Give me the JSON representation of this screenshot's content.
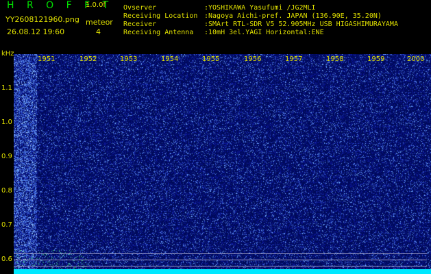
{
  "app": {
    "title": "H R O F F T",
    "version": "1.0.0f"
  },
  "file": {
    "name": "YY2608121960.png",
    "datetime": "26.08.12 19:60"
  },
  "meteor": {
    "label": "meteor",
    "count": "4"
  },
  "info": [
    {
      "label": "Ovserver",
      "value": ":YOSHIKAWA Yasufumi /JG2MLI"
    },
    {
      "label": "Receiving Location",
      "value": ":Nagoya Aichi-pref. JAPAN (136.90E, 35.20N)"
    },
    {
      "label": "Receiver",
      "value": ":SMArt RTL-SDR V5 52.905MHz USB HIGASHIMURAYAMA"
    },
    {
      "label": "Receiving Antenna",
      "value": ":10mH 3el.YAGI Horizontal:ENE"
    }
  ],
  "y_axis": {
    "unit": "kHz",
    "ticks": [
      "1.1",
      "1.0",
      "0.9",
      "0.8",
      "0.7",
      "0.6"
    ]
  },
  "x_axis": {
    "ticks": [
      "1951",
      "1952",
      "1953",
      "1954",
      "1955",
      "1956",
      "1957",
      "1958",
      "1959",
      "2000"
    ]
  },
  "colors": {
    "background": "#000000",
    "waterfall": "#000a5a",
    "noise": "#3050ff",
    "text_yellow": "#e0e000",
    "title_green": "#00e000",
    "baseline": "#00e8ff"
  }
}
